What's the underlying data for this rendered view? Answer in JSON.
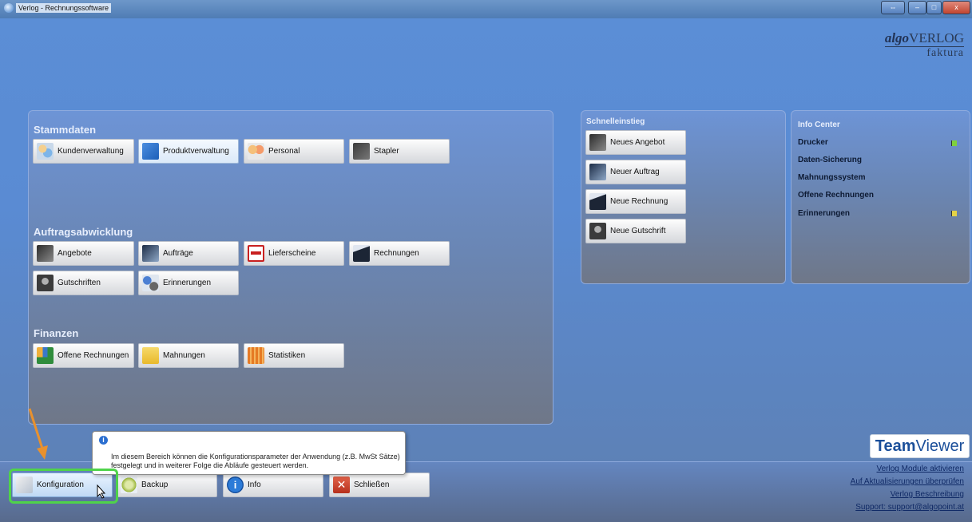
{
  "window": {
    "title": "Verlog - Rechnungssoftware"
  },
  "logo": {
    "brand_italic": "algo",
    "brand_rest": "VERLOG",
    "product": "faktura"
  },
  "sections": {
    "stammdaten": {
      "title": "Stammdaten",
      "buttons": [
        "Kundenverwaltung",
        "Produktverwaltung",
        "Personal",
        "Stapler"
      ]
    },
    "auftrag": {
      "title": "Auftragsabwicklung",
      "buttons": [
        "Angebote",
        "Aufträge",
        "Lieferscheine",
        "Rechnungen",
        "Gutschriften",
        "Erinnerungen"
      ]
    },
    "finanzen": {
      "title": "Finanzen",
      "buttons": [
        "Offene Rechnungen",
        "Mahnungen",
        "Statistiken"
      ]
    }
  },
  "quick": {
    "title": "Schnelleinstieg",
    "buttons": [
      "Neues Angebot",
      "Neuer Auftrag",
      "Neue Rechnung",
      "Neue Gutschrift"
    ]
  },
  "info_center": {
    "title": "Info Center",
    "items": [
      "Drucker",
      "Daten-Sicherung",
      "Mahnungssystem",
      "Offene Rechnungen",
      "Erinnerungen"
    ],
    "flag_colors": {
      "green": "#7fd13d",
      "yellow": "#e5d347"
    }
  },
  "bottom": {
    "buttons": [
      "Konfiguration",
      "Backup",
      "Info",
      "Schließen"
    ]
  },
  "links": [
    "Verlog Module aktivieren",
    "Auf Aktualisierungen überprüfen",
    "Verlog Beschreibung",
    "Support: support@algopoint.at"
  ],
  "teamviewer": {
    "bold": "Team",
    "rest": "Viewer"
  },
  "tooltip": {
    "line1": "Im diesem Bereich können die Konfigurationsparameter der Anwendung (z.B. MwSt Sätze)",
    "line2": "festgelegt und in weiterer Folge die Abläufe gesteuert werden."
  },
  "colors": {
    "highlight": "#4fd34a",
    "arrow": "#e8912e"
  }
}
